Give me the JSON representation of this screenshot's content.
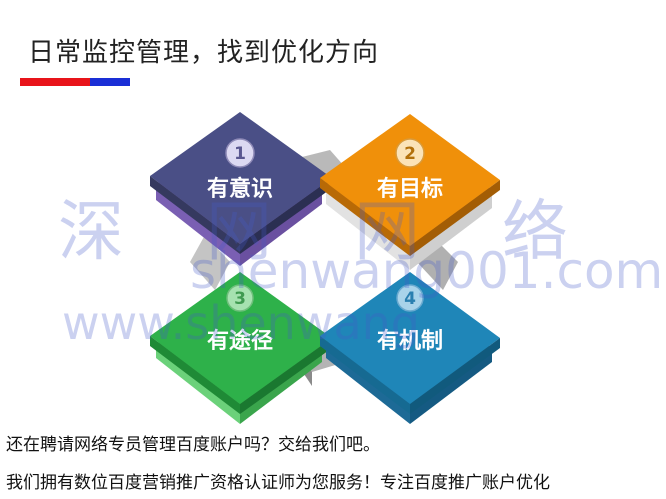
{
  "header": {
    "title": "日常监控管理，找到优化方向",
    "accent_colors": [
      "#e8141a",
      "#1a2fd6"
    ]
  },
  "diagram": {
    "cards": [
      {
        "number": "1",
        "label": "有意识",
        "color": "#4a4f86"
      },
      {
        "number": "2",
        "label": "有目标",
        "color": "#f0900a"
      },
      {
        "number": "3",
        "label": "有途径",
        "color": "#2eb14a"
      },
      {
        "number": "4",
        "label": "有机制",
        "color": "#1f86b8"
      }
    ]
  },
  "watermark": {
    "chinese": "深网网络",
    "domain": "shenwang001.com",
    "url": "www.shenwang"
  },
  "footer": {
    "line1": "还在聘请网络专员管理百度账户吗？交给我们吧。",
    "line2": "我们拥有数位百度营销推广资格认证师为您服务！专注百度推广账户优化"
  }
}
